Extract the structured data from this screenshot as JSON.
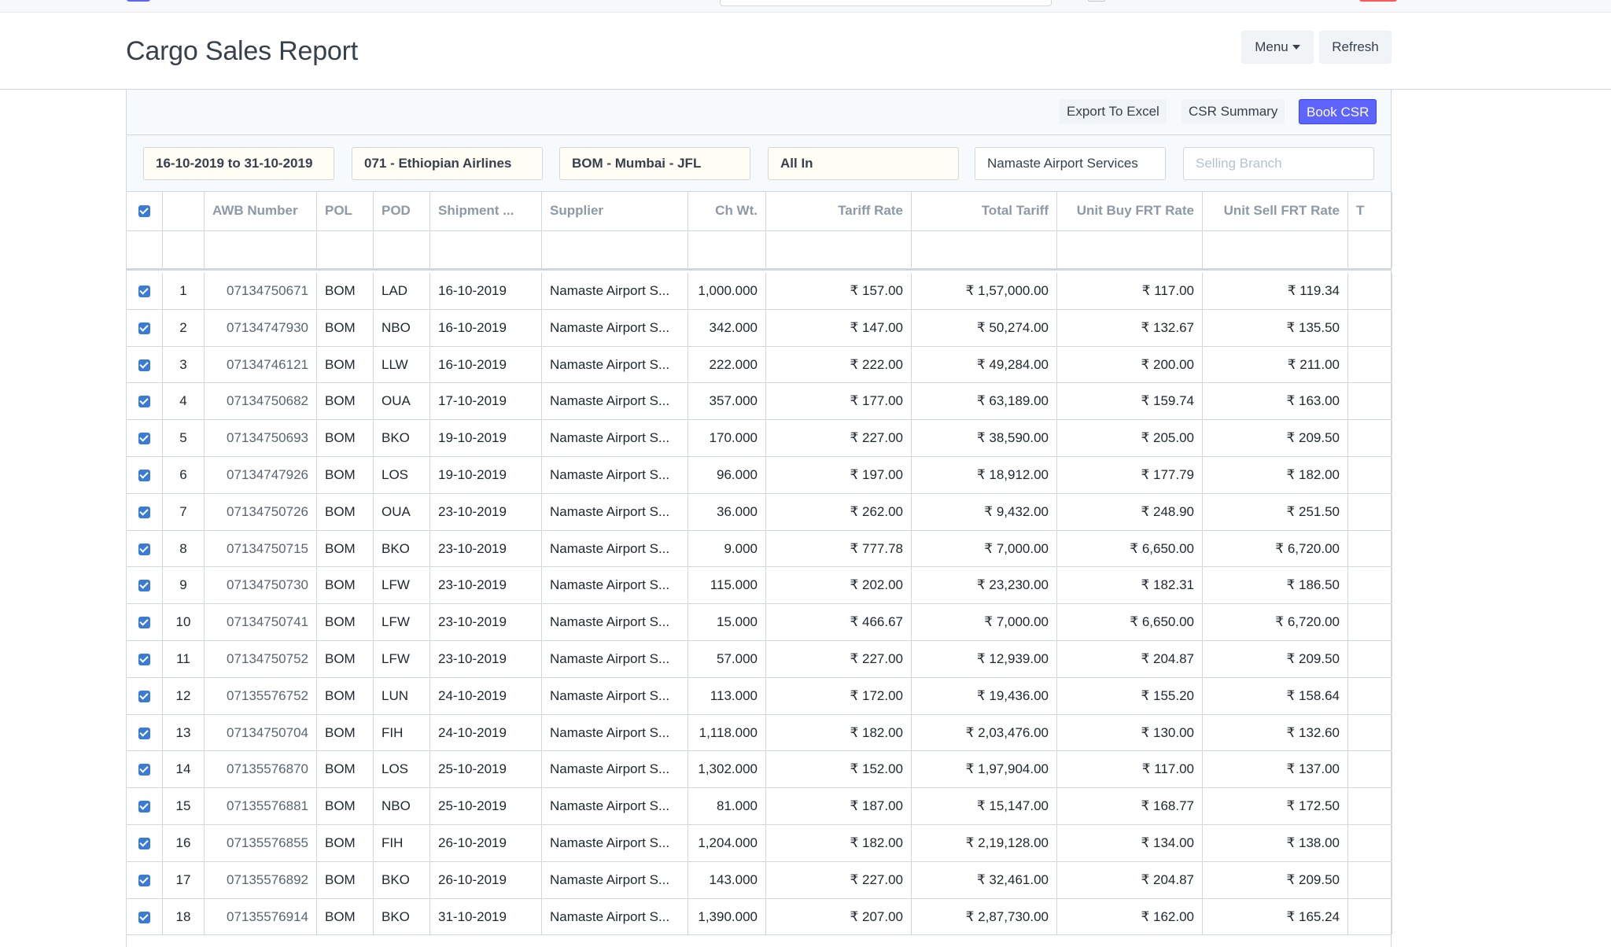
{
  "page": {
    "title": "Cargo Sales Report",
    "menu_label": "Menu",
    "refresh_label": "Refresh"
  },
  "toolbar": {
    "export_label": "Export To Excel",
    "summary_label": "CSR Summary",
    "book_label": "Book CSR",
    "book_color": "#5e64ff"
  },
  "filters": {
    "date_range": "16-10-2019 to 31-10-2019",
    "airline": "071 - Ethiopian Airlines",
    "airport": "BOM - Mumbai - JFL",
    "all_in": "All In",
    "supplier": "Namaste Airport Services",
    "branch_placeholder": "Selling Branch"
  },
  "columns": [
    "",
    "",
    "AWB Number",
    "POL",
    "POD",
    "Shipment ...",
    "Supplier",
    "Ch Wt.",
    "Tariff Rate",
    "Total Tariff",
    "Unit Buy FRT Rate",
    "Unit Sell FRT Rate",
    "T"
  ],
  "rows": [
    {
      "no": "1",
      "awb": "07134750671",
      "pol": "BOM",
      "pod": "LAD",
      "date": "16-10-2019",
      "supplier": "Namaste Airport S...",
      "chwt": "1,000.000",
      "tariff": "₹ 157.00",
      "total": "₹ 1,57,000.00",
      "buy": "₹ 117.00",
      "sell": "₹ 119.34"
    },
    {
      "no": "2",
      "awb": "07134747930",
      "pol": "BOM",
      "pod": "NBO",
      "date": "16-10-2019",
      "supplier": "Namaste Airport S...",
      "chwt": "342.000",
      "tariff": "₹ 147.00",
      "total": "₹ 50,274.00",
      "buy": "₹ 132.67",
      "sell": "₹ 135.50"
    },
    {
      "no": "3",
      "awb": "07134746121",
      "pol": "BOM",
      "pod": "LLW",
      "date": "16-10-2019",
      "supplier": "Namaste Airport S...",
      "chwt": "222.000",
      "tariff": "₹ 222.00",
      "total": "₹ 49,284.00",
      "buy": "₹ 200.00",
      "sell": "₹ 211.00"
    },
    {
      "no": "4",
      "awb": "07134750682",
      "pol": "BOM",
      "pod": "OUA",
      "date": "17-10-2019",
      "supplier": "Namaste Airport S...",
      "chwt": "357.000",
      "tariff": "₹ 177.00",
      "total": "₹ 63,189.00",
      "buy": "₹ 159.74",
      "sell": "₹ 163.00"
    },
    {
      "no": "5",
      "awb": "07134750693",
      "pol": "BOM",
      "pod": "BKO",
      "date": "19-10-2019",
      "supplier": "Namaste Airport S...",
      "chwt": "170.000",
      "tariff": "₹ 227.00",
      "total": "₹ 38,590.00",
      "buy": "₹ 205.00",
      "sell": "₹ 209.50"
    },
    {
      "no": "6",
      "awb": "07134747926",
      "pol": "BOM",
      "pod": "LOS",
      "date": "19-10-2019",
      "supplier": "Namaste Airport S...",
      "chwt": "96.000",
      "tariff": "₹ 197.00",
      "total": "₹ 18,912.00",
      "buy": "₹ 177.79",
      "sell": "₹ 182.00"
    },
    {
      "no": "7",
      "awb": "07134750726",
      "pol": "BOM",
      "pod": "OUA",
      "date": "23-10-2019",
      "supplier": "Namaste Airport S...",
      "chwt": "36.000",
      "tariff": "₹ 262.00",
      "total": "₹ 9,432.00",
      "buy": "₹ 248.90",
      "sell": "₹ 251.50"
    },
    {
      "no": "8",
      "awb": "07134750715",
      "pol": "BOM",
      "pod": "BKO",
      "date": "23-10-2019",
      "supplier": "Namaste Airport S...",
      "chwt": "9.000",
      "tariff": "₹ 777.78",
      "total": "₹ 7,000.00",
      "buy": "₹ 6,650.00",
      "sell": "₹ 6,720.00"
    },
    {
      "no": "9",
      "awb": "07134750730",
      "pol": "BOM",
      "pod": "LFW",
      "date": "23-10-2019",
      "supplier": "Namaste Airport S...",
      "chwt": "115.000",
      "tariff": "₹ 202.00",
      "total": "₹ 23,230.00",
      "buy": "₹ 182.31",
      "sell": "₹ 186.50"
    },
    {
      "no": "10",
      "awb": "07134750741",
      "pol": "BOM",
      "pod": "LFW",
      "date": "23-10-2019",
      "supplier": "Namaste Airport S...",
      "chwt": "15.000",
      "tariff": "₹ 466.67",
      "total": "₹ 7,000.00",
      "buy": "₹ 6,650.00",
      "sell": "₹ 6,720.00"
    },
    {
      "no": "11",
      "awb": "07134750752",
      "pol": "BOM",
      "pod": "LFW",
      "date": "23-10-2019",
      "supplier": "Namaste Airport S...",
      "chwt": "57.000",
      "tariff": "₹ 227.00",
      "total": "₹ 12,939.00",
      "buy": "₹ 204.87",
      "sell": "₹ 209.50"
    },
    {
      "no": "12",
      "awb": "07135576752",
      "pol": "BOM",
      "pod": "LUN",
      "date": "24-10-2019",
      "supplier": "Namaste Airport S...",
      "chwt": "113.000",
      "tariff": "₹ 172.00",
      "total": "₹ 19,436.00",
      "buy": "₹ 155.20",
      "sell": "₹ 158.64"
    },
    {
      "no": "13",
      "awb": "07134750704",
      "pol": "BOM",
      "pod": "FIH",
      "date": "24-10-2019",
      "supplier": "Namaste Airport S...",
      "chwt": "1,118.000",
      "tariff": "₹ 182.00",
      "total": "₹ 2,03,476.00",
      "buy": "₹ 130.00",
      "sell": "₹ 132.60"
    },
    {
      "no": "14",
      "awb": "07135576870",
      "pol": "BOM",
      "pod": "LOS",
      "date": "25-10-2019",
      "supplier": "Namaste Airport S...",
      "chwt": "1,302.000",
      "tariff": "₹ 152.00",
      "total": "₹ 1,97,904.00",
      "buy": "₹ 117.00",
      "sell": "₹ 137.00"
    },
    {
      "no": "15",
      "awb": "07135576881",
      "pol": "BOM",
      "pod": "NBO",
      "date": "25-10-2019",
      "supplier": "Namaste Airport S...",
      "chwt": "81.000",
      "tariff": "₹ 187.00",
      "total": "₹ 15,147.00",
      "buy": "₹ 168.77",
      "sell": "₹ 172.50"
    },
    {
      "no": "16",
      "awb": "07135576855",
      "pol": "BOM",
      "pod": "FIH",
      "date": "26-10-2019",
      "supplier": "Namaste Airport S...",
      "chwt": "1,204.000",
      "tariff": "₹ 182.00",
      "total": "₹ 2,19,128.00",
      "buy": "₹ 134.00",
      "sell": "₹ 138.00"
    },
    {
      "no": "17",
      "awb": "07135576892",
      "pol": "BOM",
      "pod": "BKO",
      "date": "26-10-2019",
      "supplier": "Namaste Airport S...",
      "chwt": "143.000",
      "tariff": "₹ 227.00",
      "total": "₹ 32,461.00",
      "buy": "₹ 204.87",
      "sell": "₹ 209.50"
    },
    {
      "no": "18",
      "awb": "07135576914",
      "pol": "BOM",
      "pod": "BKO",
      "date": "31-10-2019",
      "supplier": "Namaste Airport S...",
      "chwt": "1,390.000",
      "tariff": "₹ 207.00",
      "total": "₹ 2,87,730.00",
      "buy": "₹ 162.00",
      "sell": "₹ 165.24"
    }
  ]
}
